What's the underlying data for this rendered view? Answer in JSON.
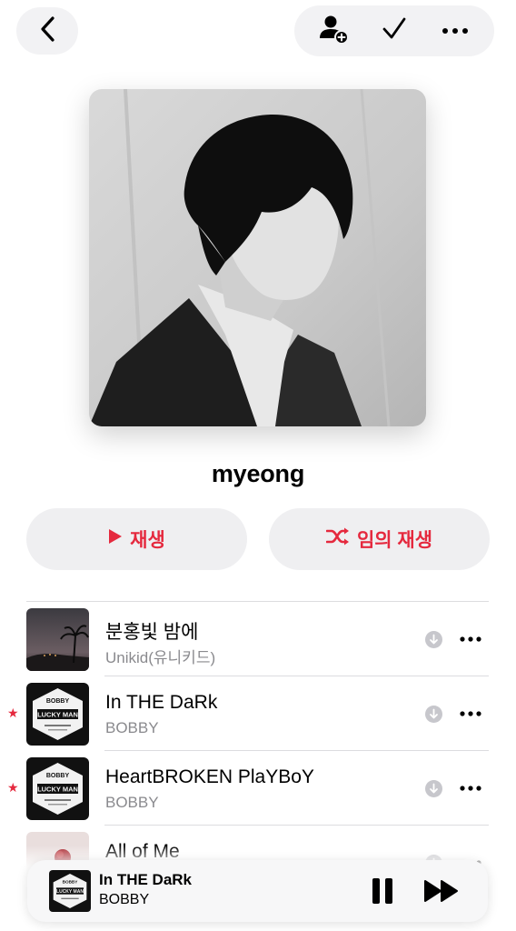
{
  "header": {
    "back_icon": "chevron-left-icon",
    "actions": [
      "add-collaborator-icon",
      "checkmark-icon",
      "more-icon"
    ]
  },
  "playlist": {
    "title": "myeong"
  },
  "buttons": {
    "play_label": "재생",
    "shuffle_label": "임의 재생"
  },
  "colors": {
    "accent": "#e5293e",
    "button_bg": "#efeff1",
    "secondary_text": "#8a8a8e"
  },
  "tracks": [
    {
      "title": "분홍빛 밤에",
      "artist": "Unikid(유니키드)",
      "favorite": false,
      "artwork": "night-palm-artwork"
    },
    {
      "title": "In THE DaRk",
      "artist": "BOBBY",
      "favorite": true,
      "artwork": "lucky-man-artwork"
    },
    {
      "title": "HeartBROKEN PlaYBoY",
      "artist": "BOBBY",
      "favorite": true,
      "artwork": "lucky-man-artwork"
    },
    {
      "title": "All of Me",
      "artist": "",
      "favorite": false,
      "artwork": "rose-artwork"
    }
  ],
  "album_art": {
    "brand": "BOBBY",
    "name": "LUCKY MAN"
  },
  "now_playing": {
    "title": "In THE DaRk",
    "artist": "BOBBY"
  }
}
